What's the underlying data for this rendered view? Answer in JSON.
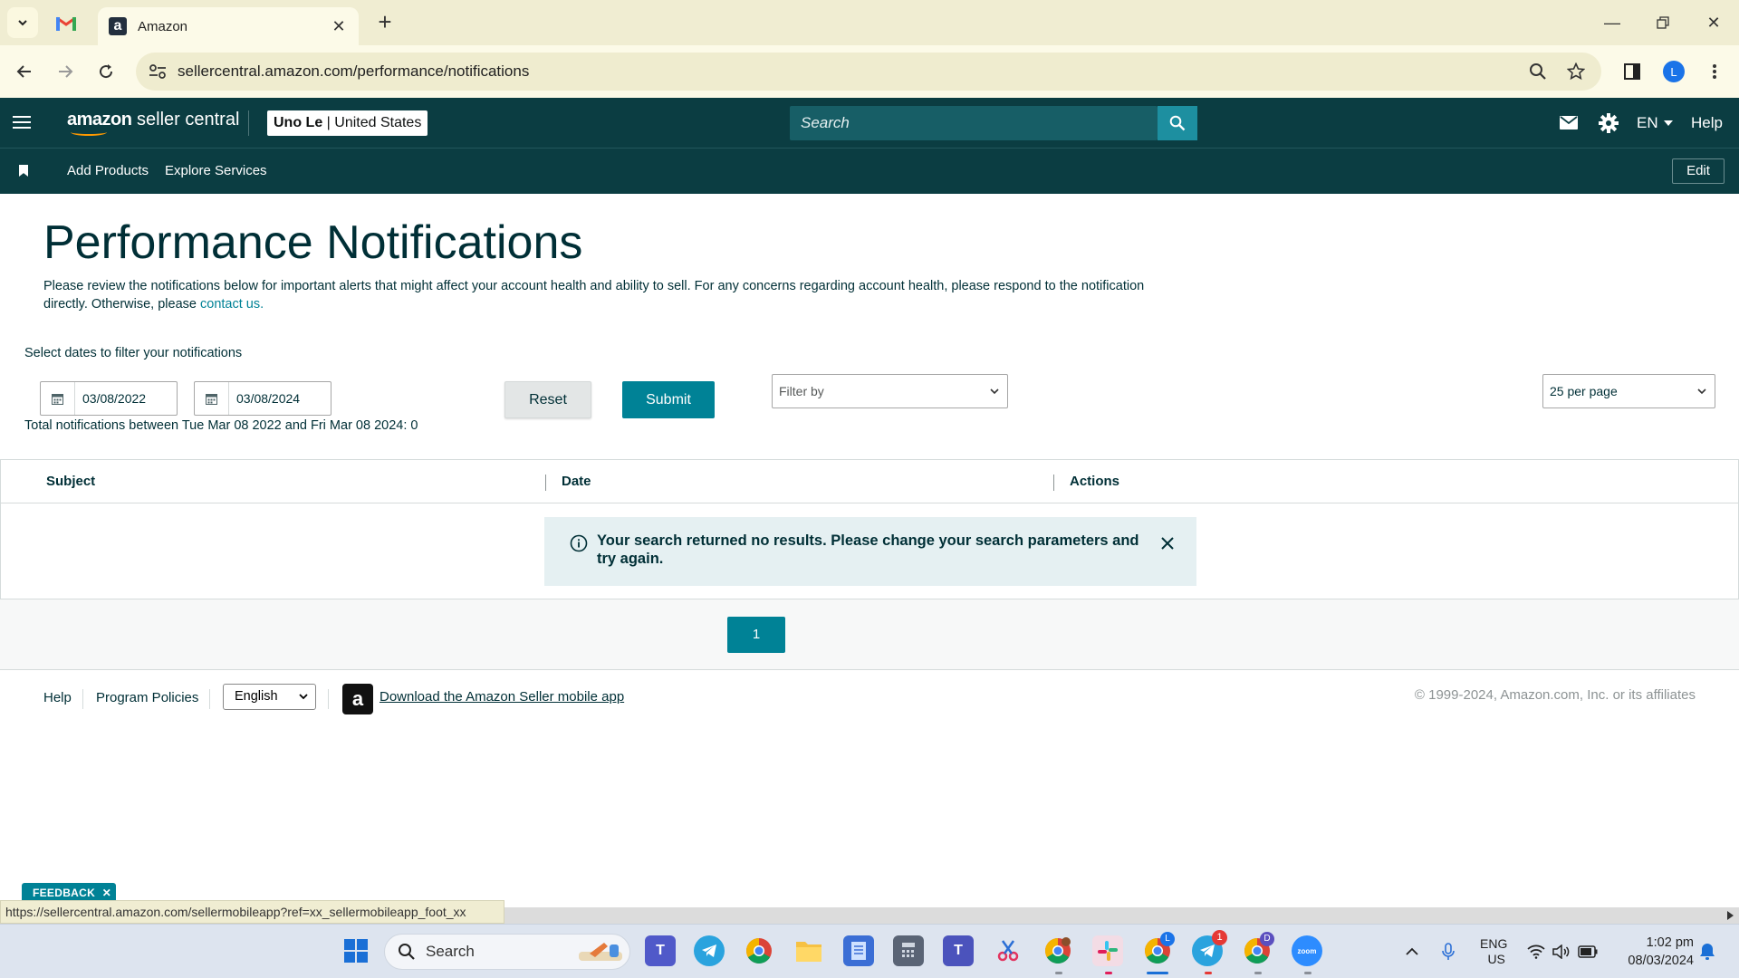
{
  "browser": {
    "tab_title": "Amazon",
    "url": "sellercentral.amazon.com/performance/notifications",
    "profile_initial": "L",
    "status_url": "https://sellercentral.amazon.com/sellermobileapp?ref=xx_sellermobileapp_foot_xx"
  },
  "header": {
    "logo_bold": "amazon",
    "logo_rest": " seller central",
    "account_name": "Uno Le",
    "account_region": " | United States",
    "search_placeholder": "Search",
    "language": "EN",
    "help": "Help"
  },
  "subnav": {
    "links": [
      "Add Products",
      "Explore Services"
    ],
    "edit": "Edit"
  },
  "page": {
    "title": "Performance Notifications",
    "intro": "Please review the notifications below for important alerts that might affect your account health and ability to sell. For any concerns regarding account health, please respond to the notification directly. Otherwise, please ",
    "intro_link": "contact us."
  },
  "filters": {
    "label": "Select dates to filter your notifications",
    "start_date": "03/08/2022",
    "end_date": "03/08/2024",
    "total_text": "Total notifications between Tue Mar 08 2022 and Fri Mar 08 2024: 0",
    "reset": "Reset",
    "submit": "Submit",
    "filter_by_placeholder": "Filter by",
    "per_page": "25 per page"
  },
  "table": {
    "columns": [
      "Subject",
      "Date",
      "Actions"
    ],
    "empty_message": "Your search returned no results. Please change your search parameters and try again."
  },
  "pagination": {
    "current_page": "1"
  },
  "footer": {
    "help": "Help",
    "program_policies": "Program Policies",
    "language": "English",
    "app_link": "Download the Amazon Seller mobile app",
    "copyright": "© 1999-2024, Amazon.com, Inc. or its affiliates"
  },
  "feedback": "FEEDBACK",
  "taskbar": {
    "search": "Search",
    "lang_top": "ENG",
    "lang_bottom": "US",
    "time": "1:02 pm",
    "date": "08/03/2024",
    "telegram_badge": "1",
    "chrome_profile_badge": "L",
    "chrome_d_badge": "D"
  },
  "colors": {
    "header_bg": "#0b3d42",
    "accent": "#008296",
    "alert_bg": "#e5f0f2"
  }
}
